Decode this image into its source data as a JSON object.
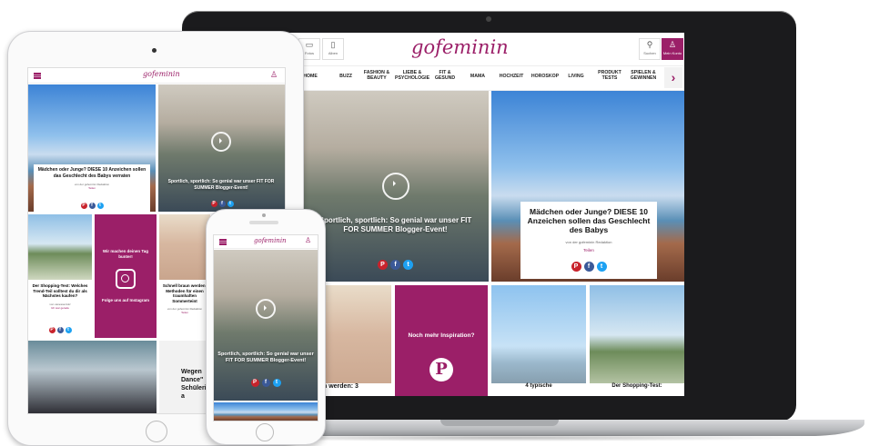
{
  "brand": {
    "logo_text": "gofeminin",
    "accent_color": "#9b1f68"
  },
  "laptop": {
    "header_buttons": [
      {
        "icon": "video-icon",
        "label": "Fotos"
      },
      {
        "icon": "tablet-icon",
        "label": "Alben"
      }
    ],
    "search_label": "Suchen",
    "login_label": "Mein Konto",
    "nav": [
      "HOME",
      "BUZZ",
      "FASHION & BEAUTY",
      "LIEBE & PSYCHOLOGIE",
      "FIT & GESUND",
      "MAMA",
      "HOCHZEIT",
      "HOROSKOP",
      "LIVING",
      "PRODUKT TESTS",
      "SPIELEN & GEWINNEN"
    ],
    "nav_next_icon": "chevron-right-icon",
    "hero_party_title": "Sportlich, sportlich: So genial war unser FIT FOR SUMMER Blogger-Event!",
    "hero_baby_title": "Mädchen oder Junge? DIESE 10 Anzeichen sollen das Geschlecht des Babys",
    "hero_baby_byline": "von der gofeminin Redaktion",
    "hero_baby_share": "Teilen",
    "pinterest_tile": "Noch mehr Inspiration?",
    "row2_captions": [
      "ll braun werden: 3",
      "4 typische",
      "Der Shopping-Test:"
    ]
  },
  "tablet": {
    "card_baby_title": "Mädchen oder Junge? DIESE 10 Anzeichen sollen das Geschlecht des Babys verraten",
    "card_baby_byline": "von der gofeminin Redaktion",
    "card_baby_share": "Teilen",
    "card_party_title": "Sportlich, sportlich: So genial war unser FIT FOR SUMMER Blogger-Event!",
    "instagram_tile_top": "Wir machen deinen Tag bunter!",
    "instagram_tile_bottom": "Folge uns auf Instagram",
    "card_shop_title": "Der Shopping-Test: Welches Trend-Teil solltest du dir als Nächstes kaufen?",
    "card_shop_byline": "von vanessa.bolz",
    "card_shop_share": "Ich war gerade",
    "card_beach_title": "Schnell braun werden: Methoden für einen traumhaften Sommerteint",
    "card_beach_byline": "von der gofeminin Redaktion",
    "card_beach_share": "Teilen",
    "card_dance_title": "Wegen Dance\" Schülerin a"
  },
  "phone": {
    "card_party_title": "Sportlich, sportlich: So genial war unser FIT FOR SUMMER Blogger-Event!"
  }
}
